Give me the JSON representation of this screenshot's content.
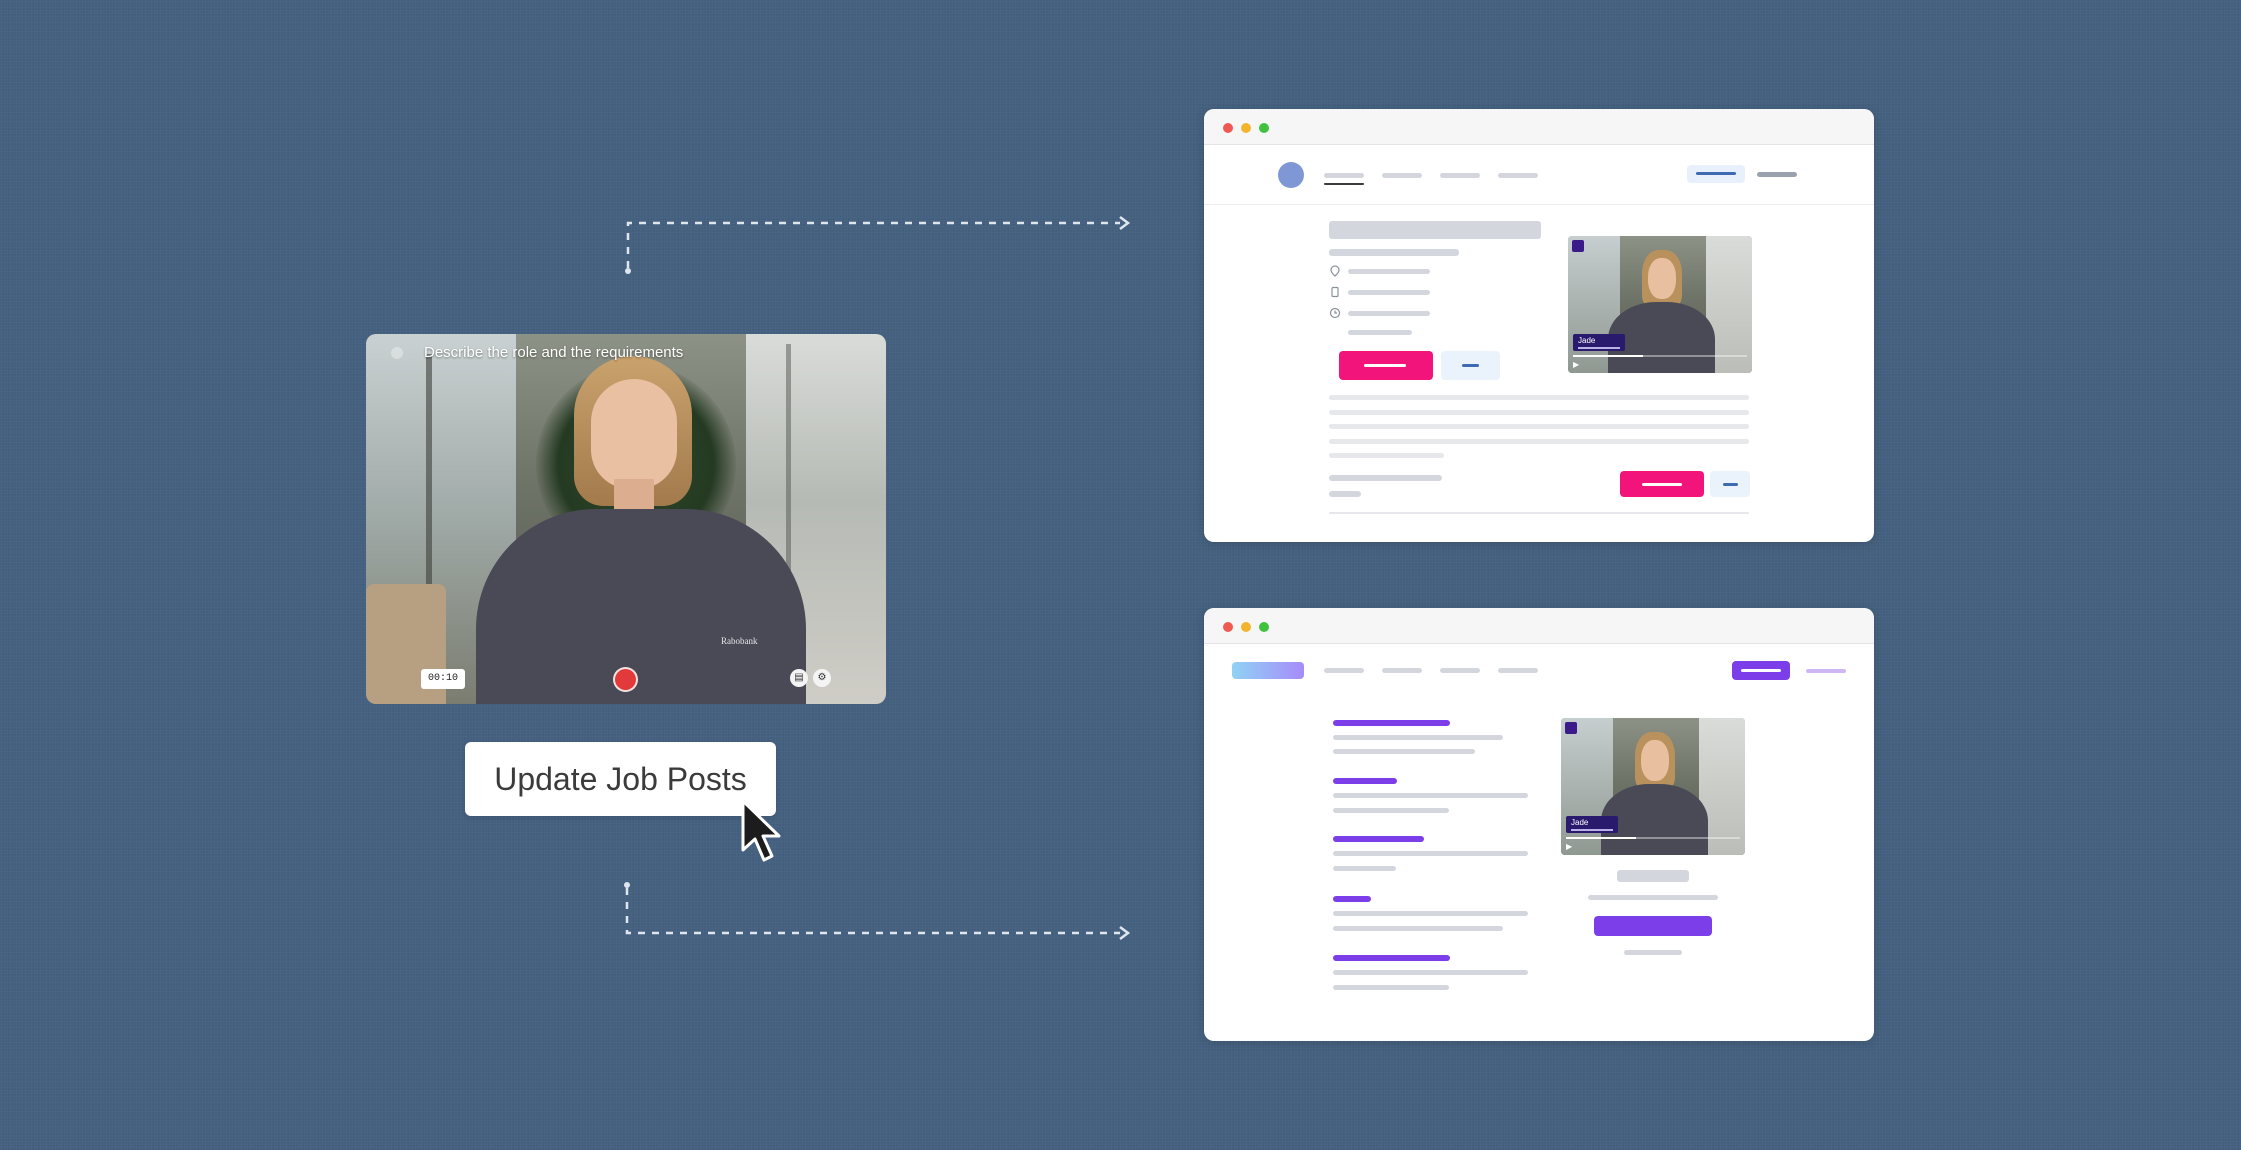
{
  "recorder": {
    "prompt": "Describe the role and the requirements",
    "timer": "00:10",
    "person_logo": "Rabobank"
  },
  "action": {
    "update_label": "Update Job Posts"
  },
  "preview_top": {
    "video_tag_name": "Jade"
  },
  "preview_bottom": {
    "video_tag_name": "Jade"
  },
  "colors": {
    "background": "#44607f",
    "pink_cta": "#f2137b",
    "purple_cta": "#7b3ee8",
    "blue_accent": "#3d6ab0",
    "record": "#e23a3a"
  },
  "icons": [
    "back-icon",
    "record-icon",
    "captions-icon",
    "settings-icon",
    "cursor-icon",
    "location-icon",
    "briefcase-icon",
    "clock-icon",
    "play-icon"
  ]
}
